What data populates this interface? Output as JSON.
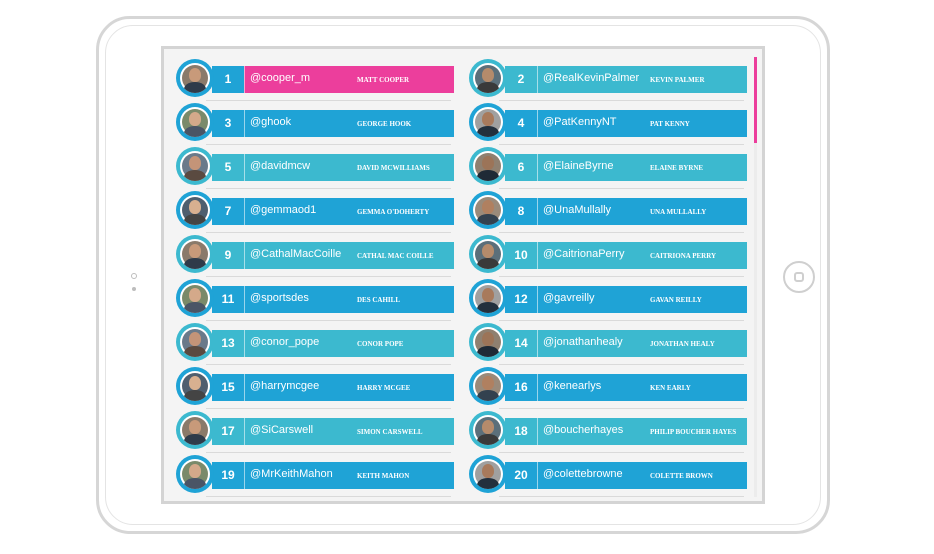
{
  "colors": {
    "bar_blue": "#1fa3d6",
    "bar_teal": "#3cb9cf",
    "highlight_pink": "#ec3e9c",
    "scroll_thumb": "#ec3e9c"
  },
  "leaderboard": [
    {
      "rank": "1",
      "handle": "@cooper_m",
      "name": "MATT COOPER",
      "highlight": true,
      "bar": "pink"
    },
    {
      "rank": "2",
      "handle": "@RealKevinPalmer",
      "name": "KEVIN PALMER",
      "highlight": false,
      "bar": "teal"
    },
    {
      "rank": "3",
      "handle": "@ghook",
      "name": "GEORGE HOOK",
      "highlight": false,
      "bar": "blue"
    },
    {
      "rank": "4",
      "handle": "@PatKennyNT",
      "name": "PAT KENNY",
      "highlight": false,
      "bar": "blue"
    },
    {
      "rank": "5",
      "handle": "@davidmcw",
      "name": "DAVID MCWILLIAMS",
      "highlight": false,
      "bar": "teal"
    },
    {
      "rank": "6",
      "handle": "@ElaineByrne",
      "name": "ELAINE BYRNE",
      "highlight": false,
      "bar": "teal"
    },
    {
      "rank": "7",
      "handle": "@gemmaod1",
      "name": "GEMMA O'DOHERTY",
      "highlight": false,
      "bar": "blue"
    },
    {
      "rank": "8",
      "handle": "@UnaMullally",
      "name": "UNA MULLALLY",
      "highlight": false,
      "bar": "blue"
    },
    {
      "rank": "9",
      "handle": "@CathalMacCoille",
      "name": "CATHAL MAC COILLE",
      "highlight": false,
      "bar": "teal"
    },
    {
      "rank": "10",
      "handle": "@CaitrionaPerry",
      "name": "CAITRIONA PERRY",
      "highlight": false,
      "bar": "teal"
    },
    {
      "rank": "11",
      "handle": "@sportsdes",
      "name": "DES CAHILL",
      "highlight": false,
      "bar": "blue"
    },
    {
      "rank": "12",
      "handle": "@gavreilly",
      "name": "GAVAN REILLY",
      "highlight": false,
      "bar": "blue"
    },
    {
      "rank": "13",
      "handle": "@conor_pope",
      "name": "CONOR POPE",
      "highlight": false,
      "bar": "teal"
    },
    {
      "rank": "14",
      "handle": "@jonathanhealy",
      "name": "JONATHAN HEALY",
      "highlight": false,
      "bar": "teal"
    },
    {
      "rank": "15",
      "handle": "@harrymcgee",
      "name": "HARRY MCGEE",
      "highlight": false,
      "bar": "blue"
    },
    {
      "rank": "16",
      "handle": "@kenearlys",
      "name": "KEN EARLY",
      "highlight": false,
      "bar": "blue"
    },
    {
      "rank": "17",
      "handle": "@SiCarswell",
      "name": "SIMON CARSWELL",
      "highlight": false,
      "bar": "teal"
    },
    {
      "rank": "18",
      "handle": "@boucherhayes",
      "name": "PHILIP BOUCHER HAYES",
      "highlight": false,
      "bar": "teal"
    },
    {
      "rank": "19",
      "handle": "@MrKeithMahon",
      "name": "KEITH MAHON",
      "highlight": false,
      "bar": "blue"
    },
    {
      "rank": "20",
      "handle": "@colettebrowne",
      "name": "COLETTE BROWN",
      "highlight": false,
      "bar": "blue"
    }
  ]
}
